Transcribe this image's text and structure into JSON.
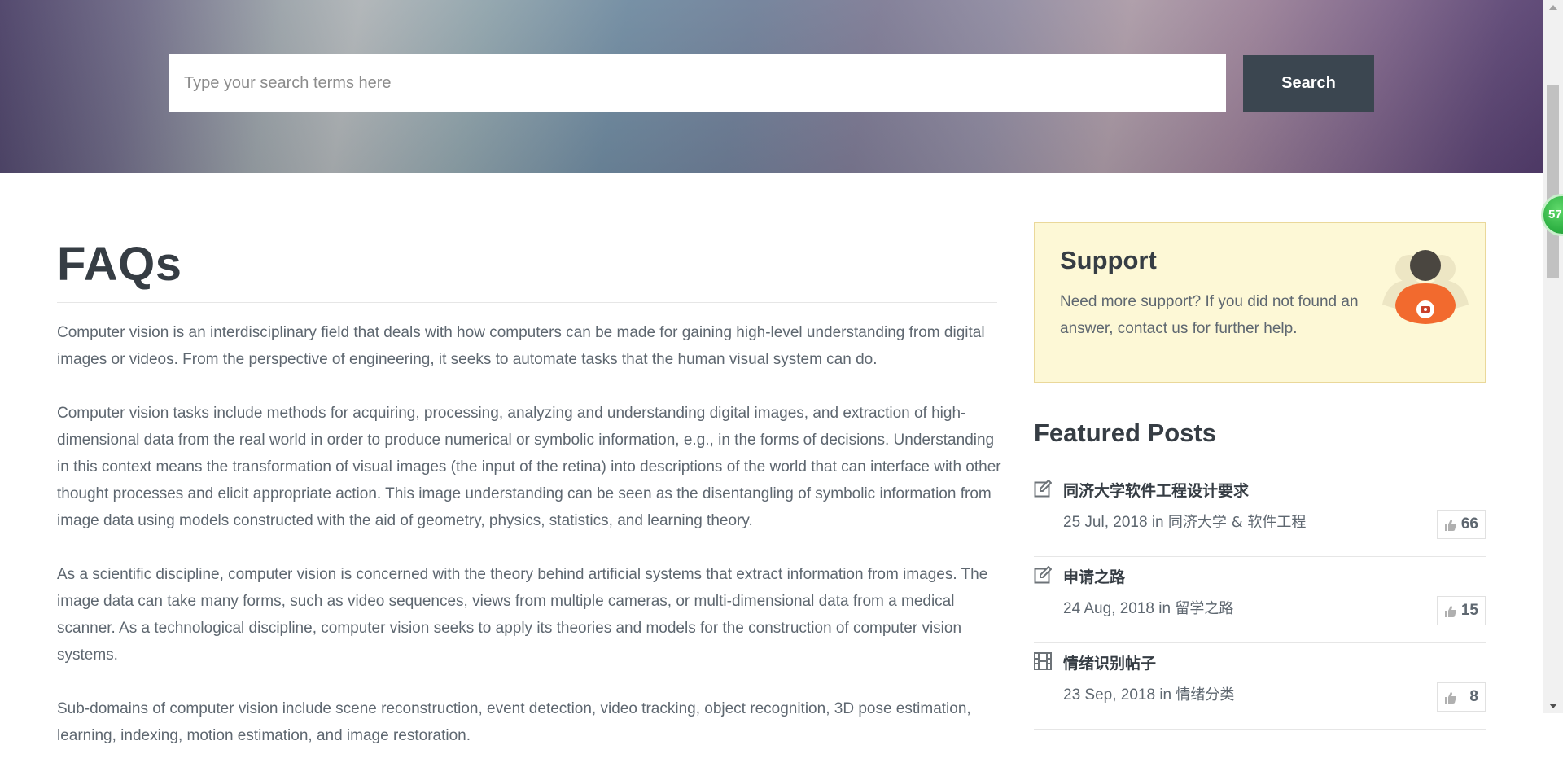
{
  "search": {
    "placeholder": "Type your search terms here",
    "button_label": "Search"
  },
  "float_badge": {
    "count": "57"
  },
  "main": {
    "title": "FAQs",
    "paragraphs": [
      "Computer vision is an interdisciplinary field that deals with how computers can be made for gaining high-level understanding from digital images or videos. From the perspective of engineering, it seeks to automate tasks that the human visual system can do.",
      "Computer vision tasks include methods for acquiring, processing, analyzing and understanding digital images, and extraction of high-dimensional data from the real world in order to produce numerical or symbolic information, e.g., in the forms of decisions. Understanding in this context means the transformation of visual images (the input of the retina) into descriptions of the world that can interface with other thought processes and elicit appropriate action. This image understanding can be seen as the disentangling of symbolic information from image data using models constructed with the aid of geometry, physics, statistics, and learning theory.",
      "As a scientific discipline, computer vision is concerned with the theory behind artificial systems that extract information from images. The image data can take many forms, such as video sequences, views from multiple cameras, or multi-dimensional data from a medical scanner. As a technological discipline, computer vision seeks to apply its theories and models for the construction of computer vision systems.",
      "Sub-domains of computer vision include scene reconstruction, event detection, video tracking, object recognition, 3D pose estimation, learning, indexing, motion estimation, and image restoration."
    ]
  },
  "sidebar": {
    "support": {
      "title": "Support",
      "text": "Need more support? If you did not found an answer, contact us for further help.",
      "icon": "support-agent-icon"
    },
    "featured_title": "Featured Posts",
    "posts": [
      {
        "title": "同济大学软件工程设计要求",
        "date": "25 Jul, 2018",
        "in": "in",
        "category": "同济大学 & 软件工程",
        "likes": "66",
        "icon": "edit-icon"
      },
      {
        "title": "申请之路",
        "date": "24 Aug, 2018",
        "in": "in",
        "category": "留学之路",
        "likes": "15",
        "icon": "edit-icon"
      },
      {
        "title": "情绪识别帖子",
        "date": "23 Sep, 2018",
        "in": "in",
        "category": "情绪分类",
        "likes": "8",
        "icon": "film-icon"
      }
    ]
  },
  "colors": {
    "search_button": "#3b4650",
    "heading": "#363d44",
    "body_text": "#5e6770",
    "support_bg": "#fdf8d6"
  }
}
